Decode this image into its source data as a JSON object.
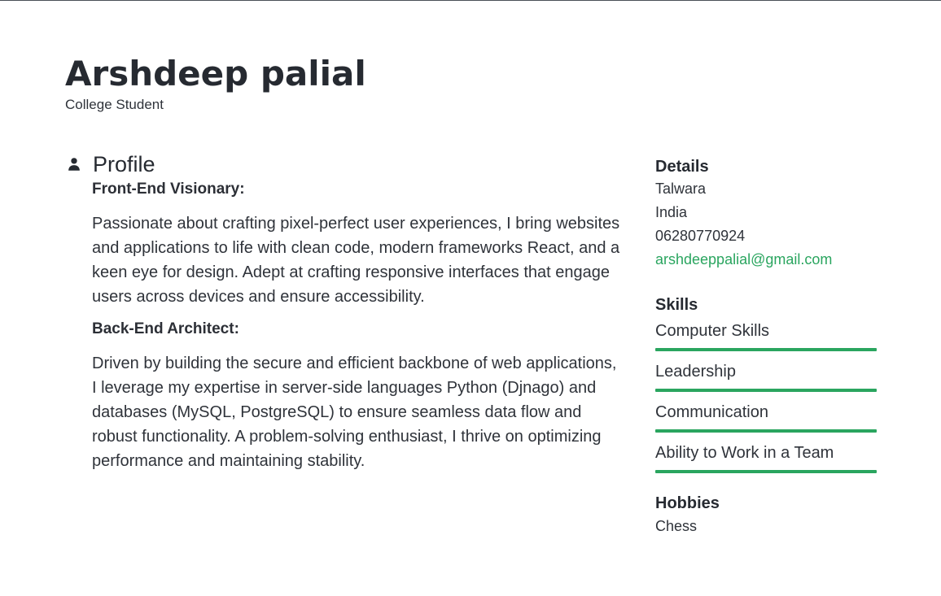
{
  "header": {
    "name": "Arshdeep palial",
    "role": "College Student"
  },
  "profile": {
    "section_title": "Profile",
    "icon": "person-icon",
    "entries": [
      {
        "title": "Front-End Visionary:",
        "text": "Passionate about crafting pixel-perfect user experiences, I bring websites and applications to life with clean code, modern frameworks React, and a keen eye for design. Adept at crafting responsive interfaces that engage users across devices and ensure accessibility."
      },
      {
        "title": "Back-End Architect:",
        "text": "Driven by building the secure and efficient backbone of web applications, I leverage my expertise in server-side languages Python (Djnago) and databases (MySQL, PostgreSQL) to ensure seamless data flow and robust functionality. A problem-solving enthusiast, I thrive on optimizing performance and maintaining stability."
      }
    ]
  },
  "details": {
    "heading": "Details",
    "city": "Talwara",
    "country": "India",
    "phone": "06280770924",
    "email": "arshdeeppalial@gmail.com"
  },
  "skills": {
    "heading": "Skills",
    "items": [
      {
        "label": "Computer Skills"
      },
      {
        "label": "Leadership"
      },
      {
        "label": "Communication"
      },
      {
        "label": "Ability to Work in a Team"
      }
    ]
  },
  "hobbies": {
    "heading": "Hobbies",
    "items": [
      "Chess"
    ]
  },
  "colors": {
    "accent": "#2aa55f",
    "text": "#2c2f36"
  }
}
